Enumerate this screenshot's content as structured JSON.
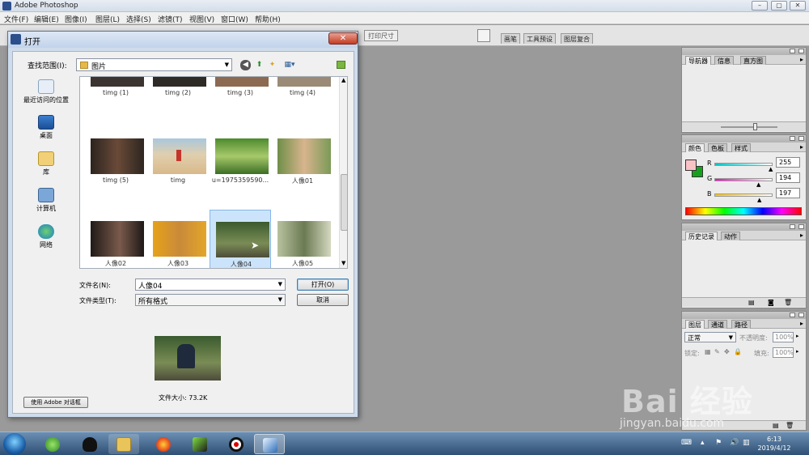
{
  "app": {
    "title": "Adobe Photoshop",
    "window_controls": [
      "–",
      "▢",
      "✕"
    ]
  },
  "menubar": [
    "文件(F)",
    "编辑(E)",
    "图像(I)",
    "图层(L)",
    "选择(S)",
    "滤镜(T)",
    "视图(V)",
    "窗口(W)",
    "帮助(H)"
  ],
  "options_bar": {
    "print_size_button": "打印尺寸",
    "well_tabs": [
      "画笔",
      "工具预设",
      "图层复合"
    ]
  },
  "dialog": {
    "title": "打开",
    "close_label": "✕",
    "look_in_label": "查找范围(I):",
    "look_in_value": "图片",
    "places": [
      "最近访问的位置",
      "桌面",
      "库",
      "计算机",
      "网络"
    ],
    "files_row0": [
      "timg (1)",
      "timg (2)",
      "timg (3)",
      "timg (4)"
    ],
    "files_row1": [
      "timg (5)",
      "timg",
      "u=1975359590...",
      "人像01"
    ],
    "files_row2": [
      "人像02",
      "人像03",
      "人像04",
      "人像05"
    ],
    "selected_file": "人像04",
    "filename_label": "文件名(N):",
    "filename_value": "人像04",
    "filetype_label": "文件类型(T):",
    "filetype_value": "所有格式",
    "open_button": "打开(O)",
    "cancel_button": "取消",
    "file_size": "文件大小: 73.2K",
    "adobe_dialog_button": "使用 Adobe 对话框"
  },
  "palettes": {
    "navigator_tabs": [
      "导航器",
      "信息",
      "直方图"
    ],
    "color_tabs": [
      "颜色",
      "色板",
      "样式"
    ],
    "color": {
      "r_label": "R",
      "r_value": "255",
      "g_label": "G",
      "g_value": "194",
      "b_label": "B",
      "b_value": "197",
      "foreground": "#f9c2c5",
      "background": "#16a11d"
    },
    "history_tabs": [
      "历史记录",
      "动作"
    ],
    "layers_tabs": [
      "图层",
      "通道",
      "路径"
    ],
    "layers": {
      "blend_mode": "正常",
      "opacity_label": "不透明度:",
      "opacity_value": "100%",
      "lock_label": "锁定:",
      "fill_label": "填充:",
      "fill_value": "100%"
    }
  },
  "taskbar": {
    "time": "6:13",
    "date": "2019/4/12"
  },
  "watermark": {
    "brand": "Bai 经验",
    "url": "jingyan.baidu.com"
  }
}
